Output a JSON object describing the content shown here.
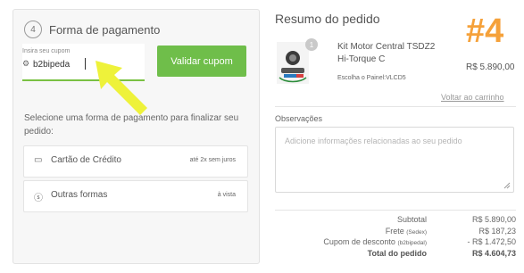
{
  "payment": {
    "step_number": "4",
    "title": "Forma de pagamento",
    "coupon_label": "Insira seu cupom",
    "coupon_value": "b2bipeda",
    "validate_button": "Validar cupom",
    "select_text": "Selecione uma forma de pagamento para finalizar seu pedido:",
    "methods": [
      {
        "label": "Cartão de Crédito",
        "note": "até 2x sem juros",
        "icon": "credit-card-icon"
      },
      {
        "label": "Outras formas",
        "note": "à vista",
        "icon": "dollar-circle-icon"
      }
    ]
  },
  "summary": {
    "title": "Resumo do pedido",
    "annotation": "#4",
    "product": {
      "quantity": "1",
      "name": "Kit Motor Central TSDZ2 Hi-Torque C",
      "panel": "Escolha o Painel:VLCD5",
      "price": "R$ 5.890,00"
    },
    "back_link": "Voltar ao carrinho",
    "observations_label": "Observações",
    "observations_placeholder": "Adicione informações relacionadas ao seu pedido",
    "totals": {
      "subtotal_label": "Subtotal",
      "subtotal_value": "R$ 5.890,00",
      "shipping_label": "Frete",
      "shipping_method": "(Sedex)",
      "shipping_value": "R$ 187,23",
      "discount_label": "Cupom de desconto",
      "discount_code": "(b2bipedal)",
      "discount_value": "- R$ 1.472,50",
      "total_label": "Total do pedido",
      "total_value": "R$ 4.604,73"
    }
  },
  "colors": {
    "accent_green": "#6fbe4a",
    "annotation_orange": "#f5a13a",
    "arrow_yellow": "#eef23a"
  }
}
